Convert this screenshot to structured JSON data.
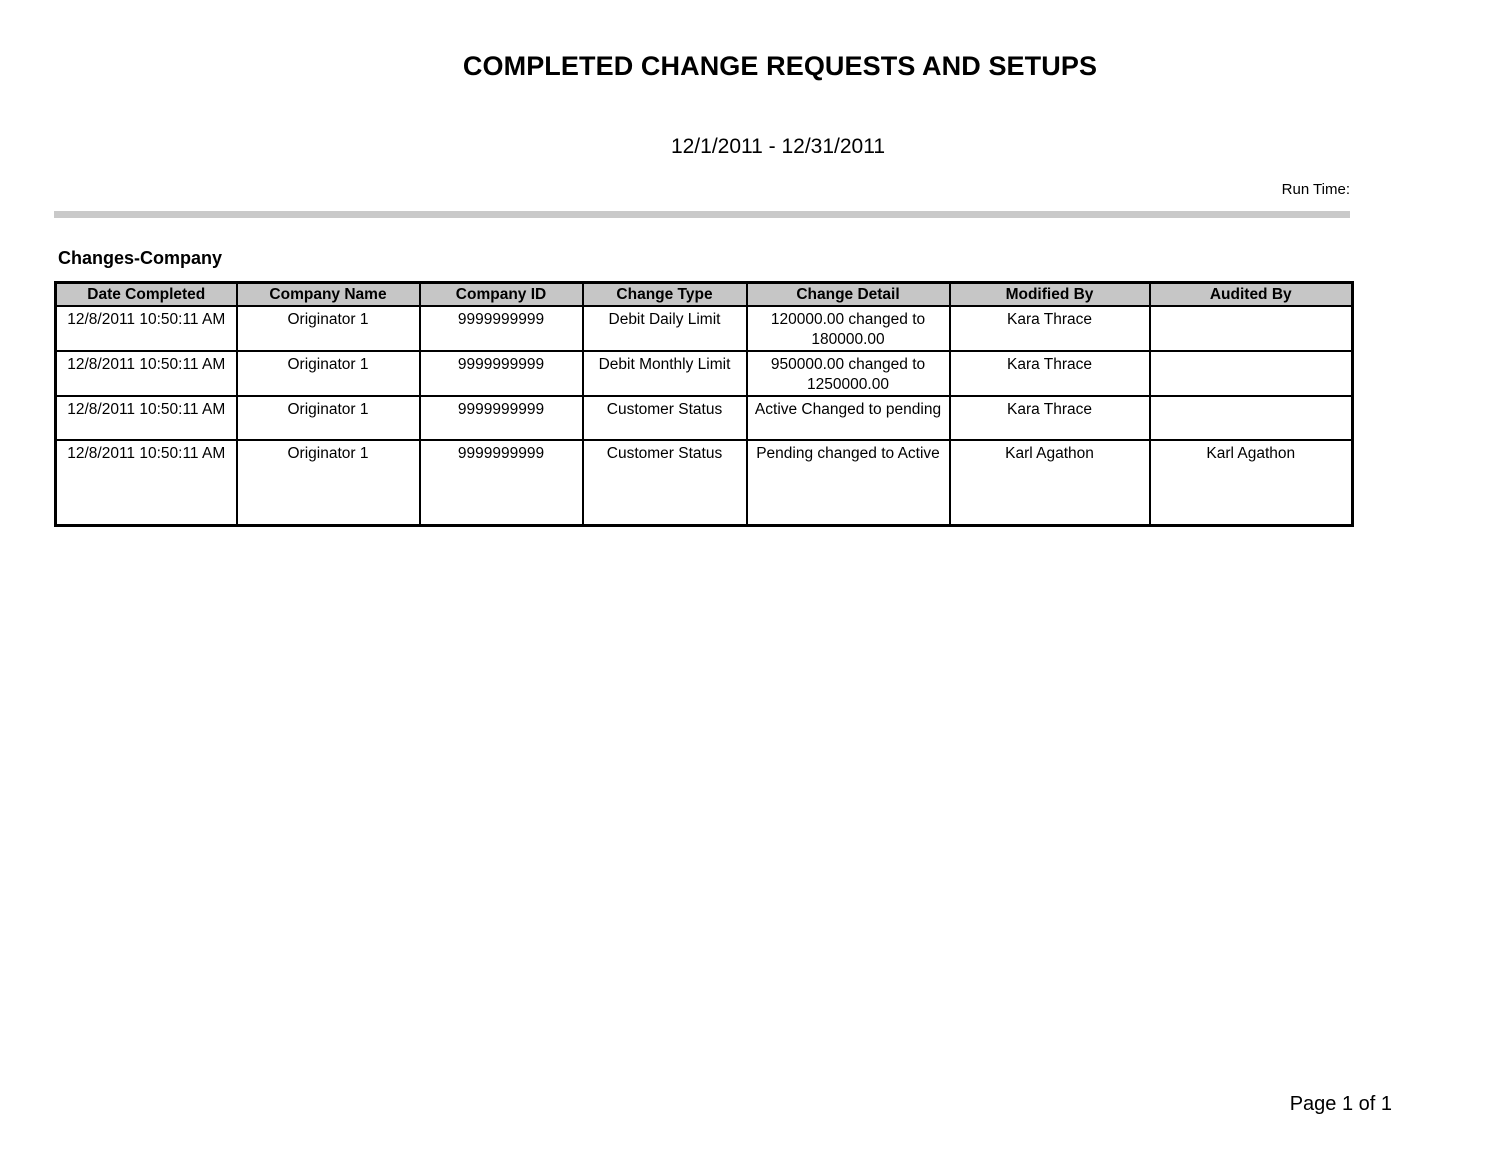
{
  "report": {
    "title": "COMPLETED CHANGE REQUESTS AND SETUPS",
    "date_range": "12/1/2011 - 12/31/2011",
    "run_time_label": "Run Time:",
    "section_heading": "Changes-Company",
    "page_footer": "Page 1 of 1"
  },
  "colors": {
    "header_fill": "#c6c6c6",
    "rule": "#c9c9c9",
    "border": "#000000",
    "text": "#000000",
    "background": "#ffffff"
  },
  "table": {
    "columns": [
      "Date Completed",
      "Company Name",
      "Company ID",
      "Change Type",
      "Change Detail",
      "Modified By",
      "Audited By"
    ],
    "rows": [
      {
        "date_completed": "12/8/2011 10:50:11 AM",
        "company_name": "Originator 1",
        "company_id": "9999999999",
        "change_type": "Debit Daily Limit",
        "change_detail": "120000.00 changed to 180000.00",
        "modified_by": "Kara Thrace",
        "audited_by": ""
      },
      {
        "date_completed": "12/8/2011 10:50:11 AM",
        "company_name": "Originator 1",
        "company_id": "9999999999",
        "change_type": "Debit Monthly Limit",
        "change_detail": "950000.00 changed to 1250000.00",
        "modified_by": "Kara Thrace",
        "audited_by": ""
      },
      {
        "date_completed": "12/8/2011 10:50:11 AM",
        "company_name": "Originator 1",
        "company_id": "9999999999",
        "change_type": "Customer Status",
        "change_detail": "Active Changed to pending",
        "modified_by": "Kara Thrace",
        "audited_by": ""
      },
      {
        "date_completed": "12/8/2011 10:50:11 AM",
        "company_name": "Originator 1",
        "company_id": "9999999999",
        "change_type": "Customer Status",
        "change_detail": "Pending changed to Active",
        "modified_by": "Karl Agathon",
        "audited_by": "Karl Agathon"
      }
    ]
  }
}
